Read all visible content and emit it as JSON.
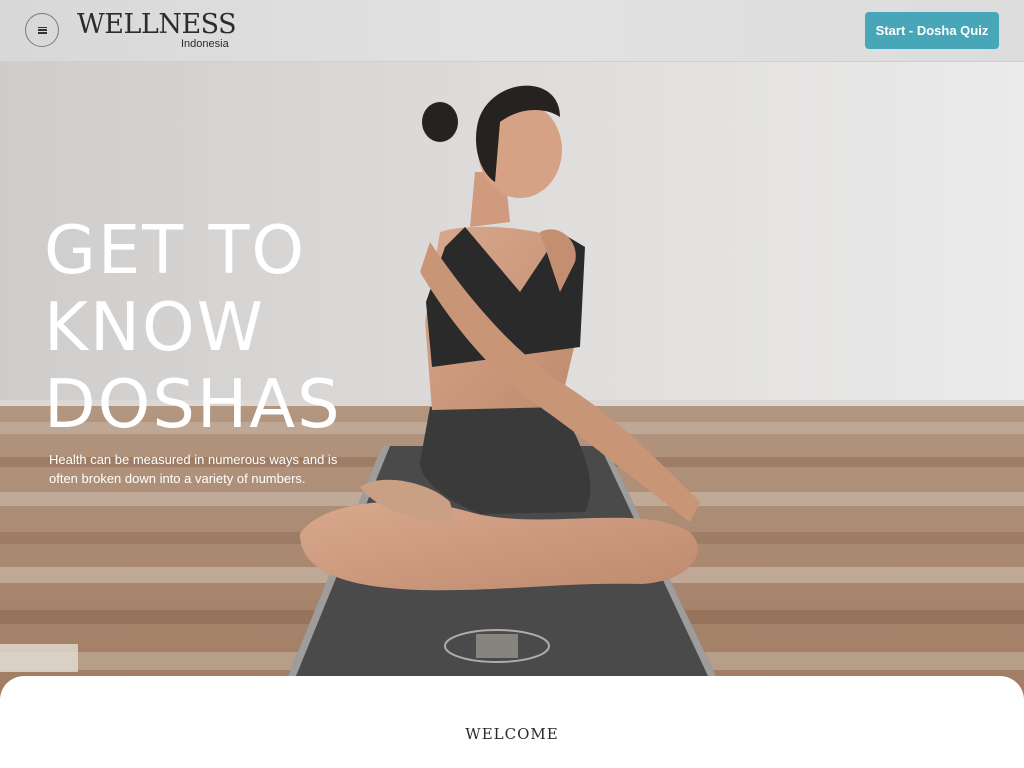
{
  "header": {
    "menu_icon": "hamburger-menu-icon",
    "logo_title": "WELLNESS",
    "logo_subtitle": "Indonesia",
    "cta_label": "Start - Dosha Quiz",
    "cta_color": "#47a6b7"
  },
  "hero": {
    "title_line1": "GET TO",
    "title_line2": "KNOW",
    "title_line3": "DOSHAS",
    "description": "Health can be measured in numerous ways and is often broken down into a variety of numbers."
  },
  "welcome": {
    "heading": "WELCOME"
  }
}
